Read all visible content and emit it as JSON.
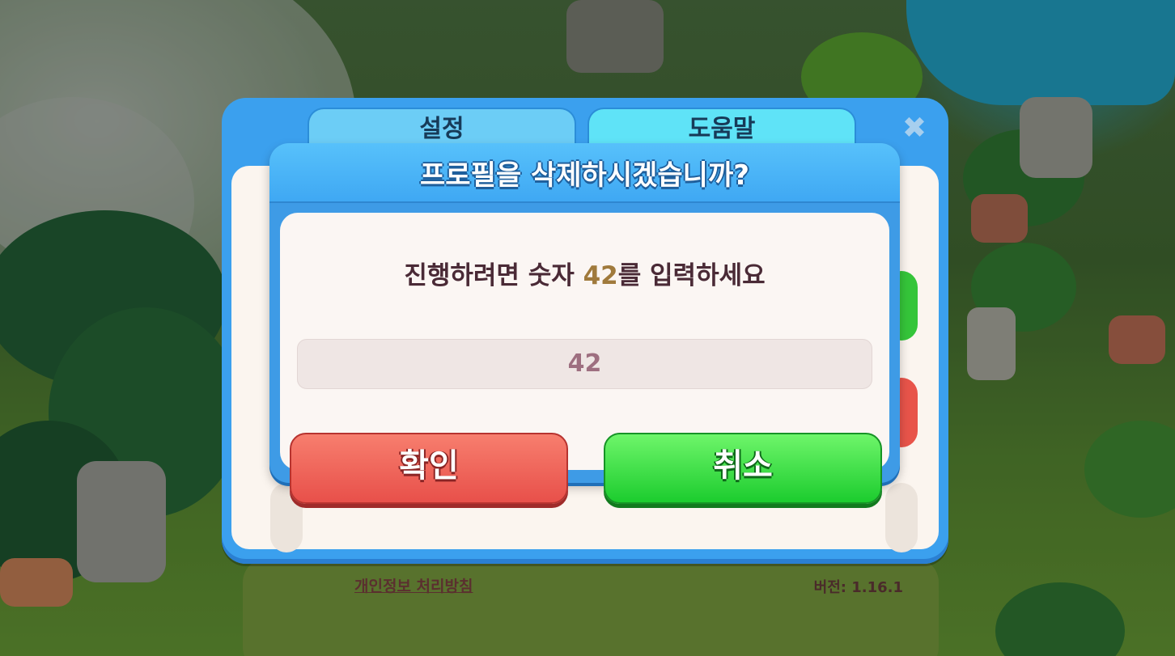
{
  "settings_panel": {
    "tabs": [
      {
        "label": "설정"
      },
      {
        "label": "도움말"
      }
    ],
    "close_icon": "close-icon",
    "privacy_link": "개인정보 처리방침",
    "version": "버전: 1.16.1"
  },
  "dialog": {
    "title": "프로필을 삭제하시겠습니까?",
    "instruction_prefix": "진행하려면 숫자 ",
    "instruction_number": "42",
    "instruction_suffix": "를 입력하세요",
    "input_value": "42",
    "confirm_label": "확인",
    "cancel_label": "취소"
  },
  "colors": {
    "panel_blue": "#3ba0ee",
    "confirm_red": "#e8504a",
    "cancel_green": "#1ccc2e",
    "highlight_number": "#a07a3c"
  }
}
